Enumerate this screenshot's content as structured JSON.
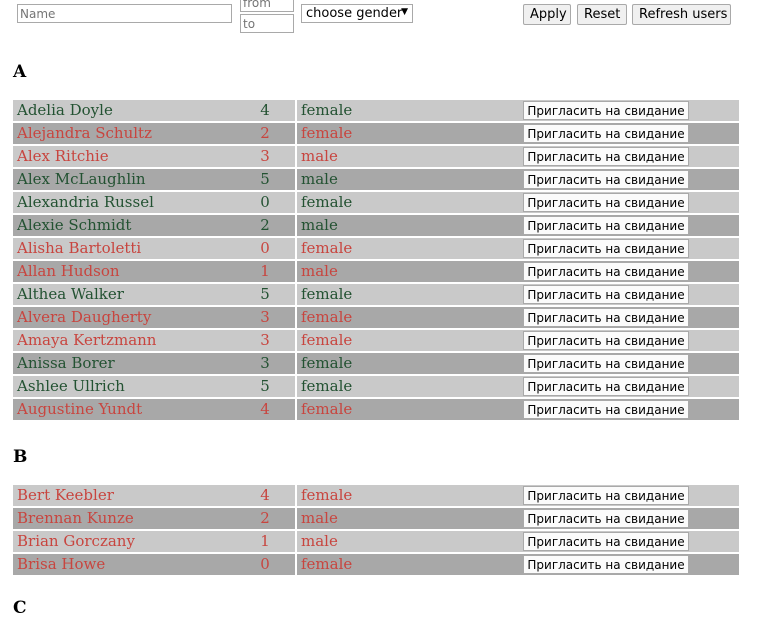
{
  "filters": {
    "name_placeholder": "Name",
    "age_from_placeholder": "from",
    "age_to_placeholder": "to",
    "gender_select": "choose gender",
    "apply_label": "Apply",
    "reset_label": "Reset",
    "refresh_label": "Refresh users"
  },
  "colors": {
    "row_light": "#c9c9c9",
    "row_dark": "#a8a8a8",
    "text_green": "#235232",
    "text_red": "#c8453f"
  },
  "groups": [
    {
      "letter": "A",
      "users": [
        {
          "name": "Adelia Doyle",
          "age": "4",
          "gender": "female",
          "color": "green",
          "tone": "light",
          "action": "Пригласить на свидание"
        },
        {
          "name": "Alejandra Schultz",
          "age": "2",
          "gender": "female",
          "color": "red",
          "tone": "dark",
          "action": "Пригласить на свидание"
        },
        {
          "name": "Alex Ritchie",
          "age": "3",
          "gender": "male",
          "color": "red",
          "tone": "light",
          "action": "Пригласить на свидание"
        },
        {
          "name": "Alex McLaughlin",
          "age": "5",
          "gender": "male",
          "color": "green",
          "tone": "dark",
          "action": "Пригласить на свидание"
        },
        {
          "name": "Alexandria Russel",
          "age": "0",
          "gender": "female",
          "color": "green",
          "tone": "light",
          "action": "Пригласить на свидание"
        },
        {
          "name": "Alexie Schmidt",
          "age": "2",
          "gender": "male",
          "color": "green",
          "tone": "dark",
          "action": "Пригласить на свидание"
        },
        {
          "name": "Alisha Bartoletti",
          "age": "0",
          "gender": "female",
          "color": "red",
          "tone": "light",
          "action": "Пригласить на свидание"
        },
        {
          "name": "Allan Hudson",
          "age": "1",
          "gender": "male",
          "color": "red",
          "tone": "dark",
          "action": "Пригласить на свидание"
        },
        {
          "name": "Althea Walker",
          "age": "5",
          "gender": "female",
          "color": "green",
          "tone": "light",
          "action": "Пригласить на свидание"
        },
        {
          "name": "Alvera Daugherty",
          "age": "3",
          "gender": "female",
          "color": "red",
          "tone": "dark",
          "action": "Пригласить на свидание"
        },
        {
          "name": "Amaya Kertzmann",
          "age": "3",
          "gender": "female",
          "color": "red",
          "tone": "light",
          "action": "Пригласить на свидание"
        },
        {
          "name": "Anissa Borer",
          "age": "3",
          "gender": "female",
          "color": "green",
          "tone": "dark",
          "action": "Пригласить на свидание"
        },
        {
          "name": "Ashlee Ullrich",
          "age": "5",
          "gender": "female",
          "color": "green",
          "tone": "light",
          "action": "Пригласить на свидание"
        },
        {
          "name": "Augustine Yundt",
          "age": "4",
          "gender": "female",
          "color": "red",
          "tone": "dark",
          "action": "Пригласить на свидание"
        }
      ]
    },
    {
      "letter": "B",
      "users": [
        {
          "name": "Bert Keebler",
          "age": "4",
          "gender": "female",
          "color": "red",
          "tone": "light",
          "action": "Пригласить на свидание"
        },
        {
          "name": "Brennan Kunze",
          "age": "2",
          "gender": "male",
          "color": "red",
          "tone": "dark",
          "action": "Пригласить на свидание"
        },
        {
          "name": "Brian Gorczany",
          "age": "1",
          "gender": "male",
          "color": "red",
          "tone": "light",
          "action": "Пригласить на свидание"
        },
        {
          "name": "Brisa Howe",
          "age": "0",
          "gender": "female",
          "color": "red",
          "tone": "dark",
          "action": "Пригласить на свидание"
        }
      ]
    },
    {
      "letter": "C",
      "users": []
    }
  ]
}
